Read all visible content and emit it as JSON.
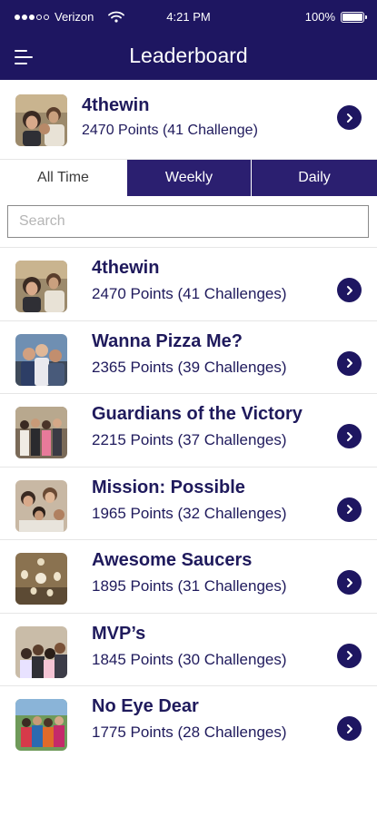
{
  "status_bar": {
    "carrier": "Verizon",
    "time": "4:21 PM",
    "battery": "100%"
  },
  "header": {
    "title": "Leaderboard"
  },
  "my_team": {
    "name": "4thewin",
    "points": "2470 Points (41 Challenge)"
  },
  "tabs": [
    {
      "label": "All Time",
      "selected": true
    },
    {
      "label": "Weekly",
      "selected": false
    },
    {
      "label": "Daily",
      "selected": false
    }
  ],
  "search": {
    "placeholder": "Search",
    "value": ""
  },
  "leaderboard": [
    {
      "name": "4thewin",
      "points": "2470 Points (41 Challenges)"
    },
    {
      "name": "Wanna Pizza Me?",
      "points": "2365 Points (39 Challenges)"
    },
    {
      "name": "Guardians of the Victory",
      "points": "2215 Points (37 Challenges)"
    },
    {
      "name": "Mission: Possible",
      "points": "1965 Points (32 Challenges)"
    },
    {
      "name": "Awesome Saucers",
      "points": "1895 Points (31 Challenges)"
    },
    {
      "name": "MVP’s",
      "points": "1845 Points (30 Challenges)"
    },
    {
      "name": "No Eye Dear",
      "points": "1775 Points (28 Challenges)"
    }
  ],
  "colors": {
    "primary": "#1e1661",
    "tab_bg": "#2b1f70",
    "text": "#1f1a5c",
    "divider": "#e6e6e6"
  },
  "icons": {
    "menu": "hamburger-menu-icon",
    "row_action": "chevron-right-circle-icon",
    "wifi": "wifi-icon",
    "battery": "battery-icon",
    "signal": "signal-dots-icon"
  }
}
